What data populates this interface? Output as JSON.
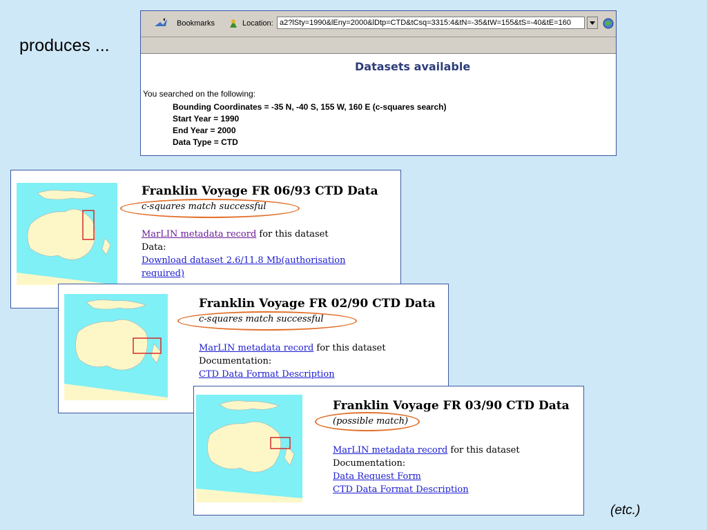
{
  "slide": {
    "produces_text": "produces ...",
    "etc_text": "(etc.)"
  },
  "browser": {
    "bookmarks_label": "Bookmarks",
    "location_label": "Location:",
    "url": "a2?lSty=1990&lEny=2000&lDtp=CTD&tCsq=3315:4&tN=-35&tW=155&tS=-40&tE=160",
    "page_title": "Datasets available",
    "searched_text": "You searched on the following:",
    "criteria": [
      "Bounding Coordinates = -35 N, -40 S, 155 W, 160 E (c-squares search)",
      "Start Year = 1990",
      "End Year = 2000",
      "Data Type = CTD"
    ]
  },
  "cards": [
    {
      "title": "Franklin Voyage FR 06/93 CTD Data",
      "status": "c-squares match successful",
      "metadata_link": "MarLIN metadata record",
      "metadata_suffix": " for this dataset",
      "section_label": "Data:",
      "links": [
        "Download dataset 2.6/11.8 Mb(authorisation",
        "required)"
      ]
    },
    {
      "title": "Franklin Voyage FR 02/90 CTD Data",
      "status": "c-squares match successful",
      "metadata_link": "MarLIN metadata record",
      "metadata_suffix": " for this dataset",
      "section_label": "Documentation:",
      "links": [
        "CTD Data Format Description"
      ]
    },
    {
      "title": "Franklin Voyage FR 03/90 CTD Data",
      "status": "(possible match)",
      "metadata_link": "MarLIN metadata record",
      "metadata_suffix": " for this dataset",
      "section_label": "Documentation:",
      "links": [
        "Data Request Form",
        "CTD Data Format Description"
      ]
    }
  ],
  "colors": {
    "background": "#cfe8f7",
    "highlight_oval": "#e2702a",
    "map_sea": "#7ff0f5",
    "map_land": "#fdf7c8",
    "search_box": "#d42a2a"
  }
}
